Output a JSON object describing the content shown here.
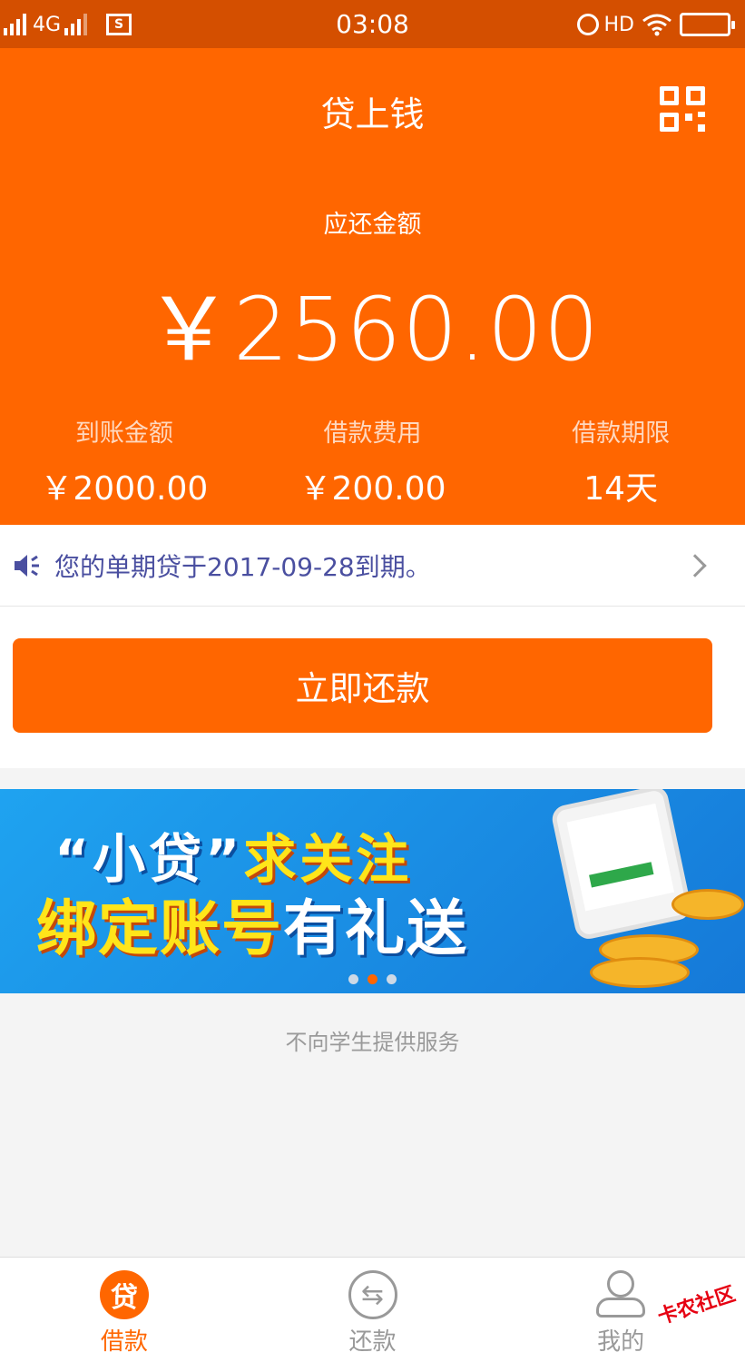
{
  "status_bar": {
    "network_left": "4G",
    "network": "4G",
    "time": "03:08",
    "hd": "HD",
    "screenshot_icon": "S"
  },
  "header": {
    "title": "贷上钱",
    "due_label": "应还金额",
    "due_amount": "￥2560.00",
    "stats": [
      {
        "label": "到账金额",
        "value": "￥2000.00"
      },
      {
        "label": "借款费用",
        "value": "￥200.00"
      },
      {
        "label": "借款期限",
        "value": "14天"
      }
    ]
  },
  "notice": {
    "text": "您的单期贷于2017-09-28到期。"
  },
  "repay_button": "立即还款",
  "banner": {
    "line1_a": "“小贷”",
    "line1_b": "求关注",
    "line2_a": "绑定账号",
    "line2_b": "有礼送"
  },
  "footer_note": "不向学生提供服务",
  "tabs": [
    {
      "label": "借款",
      "icon_text": "贷"
    },
    {
      "label": "还款",
      "icon_text": "⇆"
    },
    {
      "label": "我的"
    }
  ],
  "watermark": "卡农社区",
  "colors": {
    "accent": "#ff6600",
    "status_bar": "#d44f00",
    "notice_text": "#4a4fa0"
  }
}
